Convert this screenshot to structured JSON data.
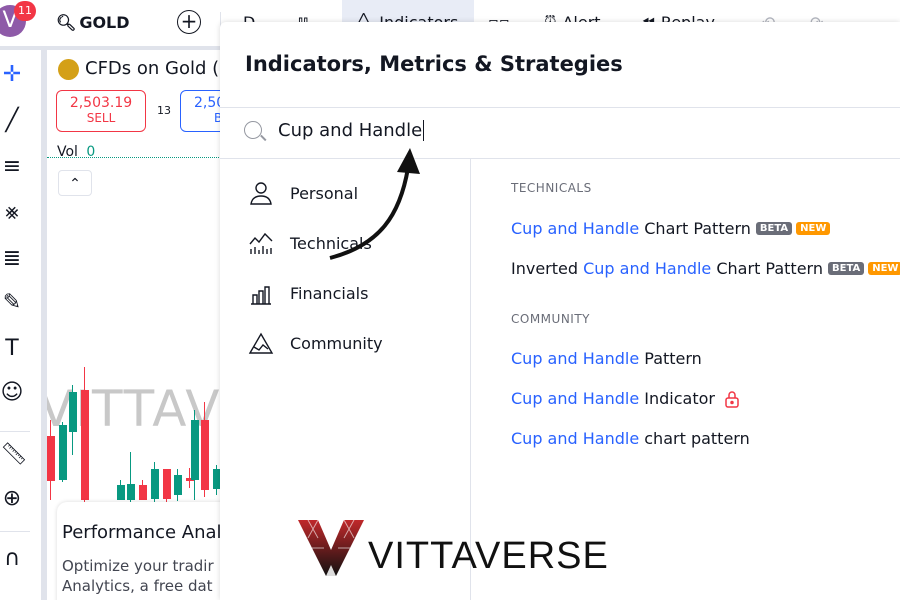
{
  "topbar": {
    "avatar_letter": "V",
    "notification_count": "11",
    "symbol": "GOLD",
    "interval": "D",
    "indicators_label": "Indicators",
    "alert_label": "Alert",
    "replay_label": "Replay"
  },
  "chart": {
    "instrument": "CFDs on Gold (U",
    "sell_price": "2,503.19",
    "sell_label": "SELL",
    "spread": "13",
    "buy_price": "2,50",
    "buy_label": "B",
    "vol_label": "Vol",
    "vol_value": "0",
    "watermark": "VITTAVE",
    "promo_title": "Performance Anal",
    "promo_line1": "Optimize your tradir",
    "promo_line2": "Analytics, a free dat"
  },
  "modal": {
    "title": "Indicators, Metrics & Strategies",
    "search_value": "Cup and Handle",
    "nav": [
      {
        "label": "Personal",
        "icon": "person-icon"
      },
      {
        "label": "Technicals",
        "icon": "technicals-icon"
      },
      {
        "label": "Financials",
        "icon": "financials-icon"
      },
      {
        "label": "Community",
        "icon": "community-icon"
      }
    ],
    "sections": [
      {
        "heading": "TECHNICALS",
        "items": [
          {
            "pre": "",
            "match": "Cup and Handle",
            "post": " Chart Pattern",
            "badges": [
              "BETA",
              "NEW"
            ]
          },
          {
            "pre": "Inverted ",
            "match": "Cup and Handle",
            "post": " Chart Pattern",
            "badges": [
              "BETA",
              "NEW"
            ]
          }
        ]
      },
      {
        "heading": "COMMUNITY",
        "items": [
          {
            "pre": "",
            "match": "Cup and Handle",
            "post": " Pattern",
            "badges": []
          },
          {
            "pre": "",
            "match": "Cup and Handle",
            "post": " Indicator",
            "badges": [],
            "locked": true
          },
          {
            "pre": "",
            "match": "Cup and Handle",
            "post": " chart pattern",
            "badges": []
          }
        ]
      }
    ]
  },
  "logo": {
    "text": "VITTAVERSE"
  },
  "colors": {
    "accent": "#2962ff",
    "sell": "#f23645",
    "up": "#089981",
    "beta": "#6a6d78",
    "new": "#ff9800"
  }
}
